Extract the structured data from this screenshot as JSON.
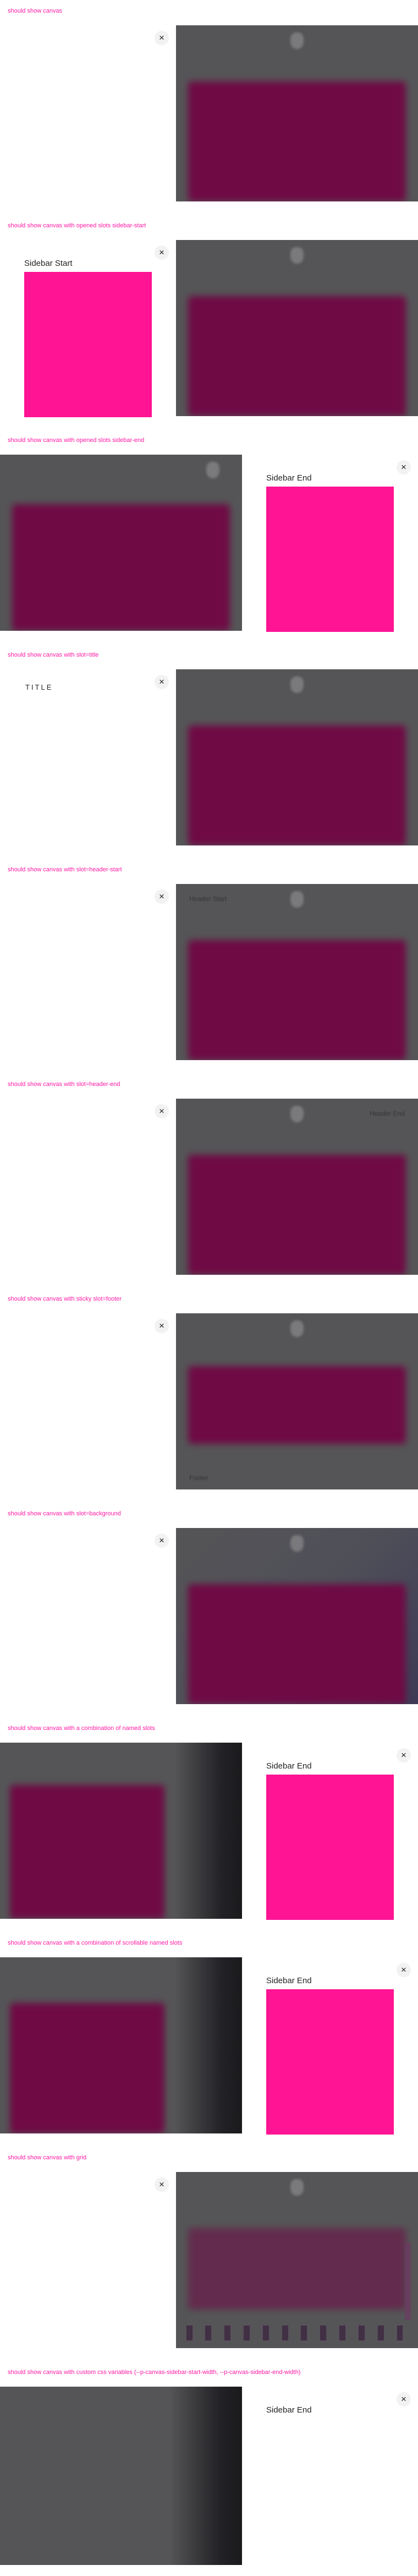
{
  "close_glyph": "×",
  "accent_color": "#ff1aa4",
  "sidebar_color": "#ff1493",
  "sections": [
    {
      "heading": "should show canvas"
    },
    {
      "heading": "should show canvas with opened slots sidebar-start",
      "sidebar_title": "Sidebar Start"
    },
    {
      "heading": "should show canvas with opened slots sidebar-end",
      "sidebar_title": "Sidebar End"
    },
    {
      "heading": "should show canvas with slot=title",
      "title": "TITLE"
    },
    {
      "heading": "should show canvas with slot=header-start",
      "header_text": "Header Start"
    },
    {
      "heading": "should show canvas with slot=header-end",
      "header_text": "Header End"
    },
    {
      "heading": "should show canvas with sticky slot=footer",
      "footer_text": "Footer"
    },
    {
      "heading": "should show canvas with slot=background"
    },
    {
      "heading": "should show canvas with a combination of named slots",
      "sidebar_title": "Sidebar End"
    },
    {
      "heading": "should show canvas with a combination of scrollable named slots",
      "sidebar_title": "Sidebar End"
    },
    {
      "heading": "should show canvas with grid"
    },
    {
      "heading": "should show canvas with custom css variables (--p-canvas-sidebar-start-width, --p-canvas-sidebar-end-width)",
      "sidebar_title": "Sidebar End"
    }
  ]
}
